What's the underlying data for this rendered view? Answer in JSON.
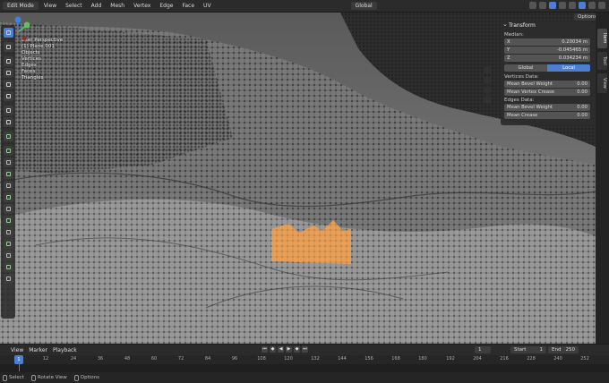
{
  "header": {
    "mode": "Edit Mode",
    "menus": [
      "View",
      "Select",
      "Add",
      "Mesh",
      "Vertex",
      "Edge",
      "Face",
      "UV"
    ],
    "orientation": "Global"
  },
  "viewport": {
    "overlay_lines": [
      "User Perspective",
      "(1) Plane.001",
      "Objects",
      "Vertices",
      "Edges",
      "Faces",
      "Triangles"
    ]
  },
  "npanel": {
    "title": "Transform",
    "median_label": "Median:",
    "x_label": "X",
    "x_value": "0.20034 m",
    "y_label": "Y",
    "y_value": "-0.045465 m",
    "z_label": "Z",
    "z_value": "0.034234 m",
    "global_label": "Global",
    "local_label": "Local",
    "vertex_data_label": "Vertices Data:",
    "mean_bevel_weight_label": "Mean Bevel Weight",
    "mean_bevel_weight_value": "0.00",
    "mean_vertex_crease_label": "Mean Vertex Crease",
    "mean_vertex_crease_value": "0.00",
    "edges_data_label": "Edges Data:",
    "edge_bevel_weight_label": "Mean Bevel Weight",
    "edge_bevel_weight_value": "0.00",
    "mean_crease_label": "Mean Crease",
    "mean_crease_value": "0.00"
  },
  "side_tabs": [
    "Item",
    "Tool",
    "View"
  ],
  "options_label": "Options",
  "timeline": {
    "menus": [
      "View",
      "Marker",
      "Playback"
    ],
    "current_frame": "1",
    "start_label": "Start",
    "start_value": "1",
    "end_label": "End",
    "end_value": "250",
    "ticks": [
      "1",
      "12",
      "24",
      "36",
      "48",
      "60",
      "72",
      "84",
      "96",
      "108",
      "120",
      "132",
      "144",
      "156",
      "168",
      "180",
      "192",
      "204",
      "216",
      "228",
      "240",
      "252"
    ]
  },
  "status": {
    "select": "Select",
    "rotate": "Rotate View",
    "options": "Options"
  },
  "colors": {
    "accent": "#4a7fd1",
    "selection": "#f0a050",
    "background": "#1d1d1d"
  }
}
